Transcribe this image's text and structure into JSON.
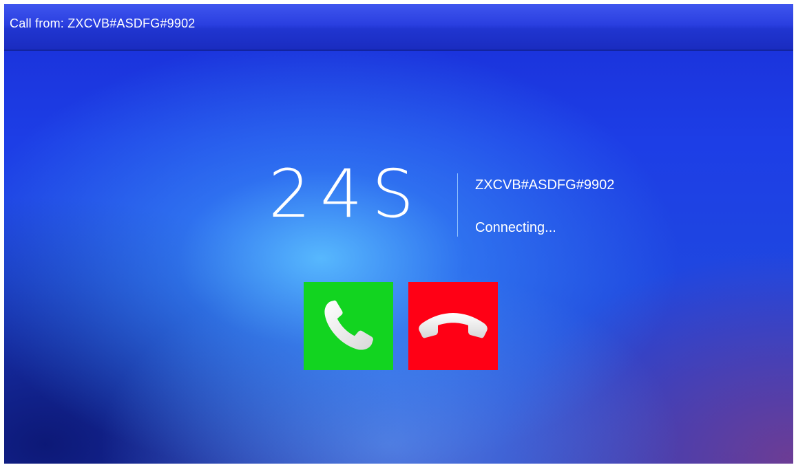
{
  "title_bar": {
    "title": "Call from: ZXCVB#ASDFG#9902"
  },
  "call": {
    "timer": "24S",
    "caller_id": "ZXCVB#ASDFG#9902",
    "status": "Connecting..."
  },
  "buttons": {
    "accept": {
      "icon": "phone-icon",
      "color": "#12d420"
    },
    "reject": {
      "icon": "hang-up-icon",
      "color": "#ff0015"
    }
  },
  "colors": {
    "background_primary": "#1f47e0",
    "title_bar": "#2a3fe0"
  }
}
